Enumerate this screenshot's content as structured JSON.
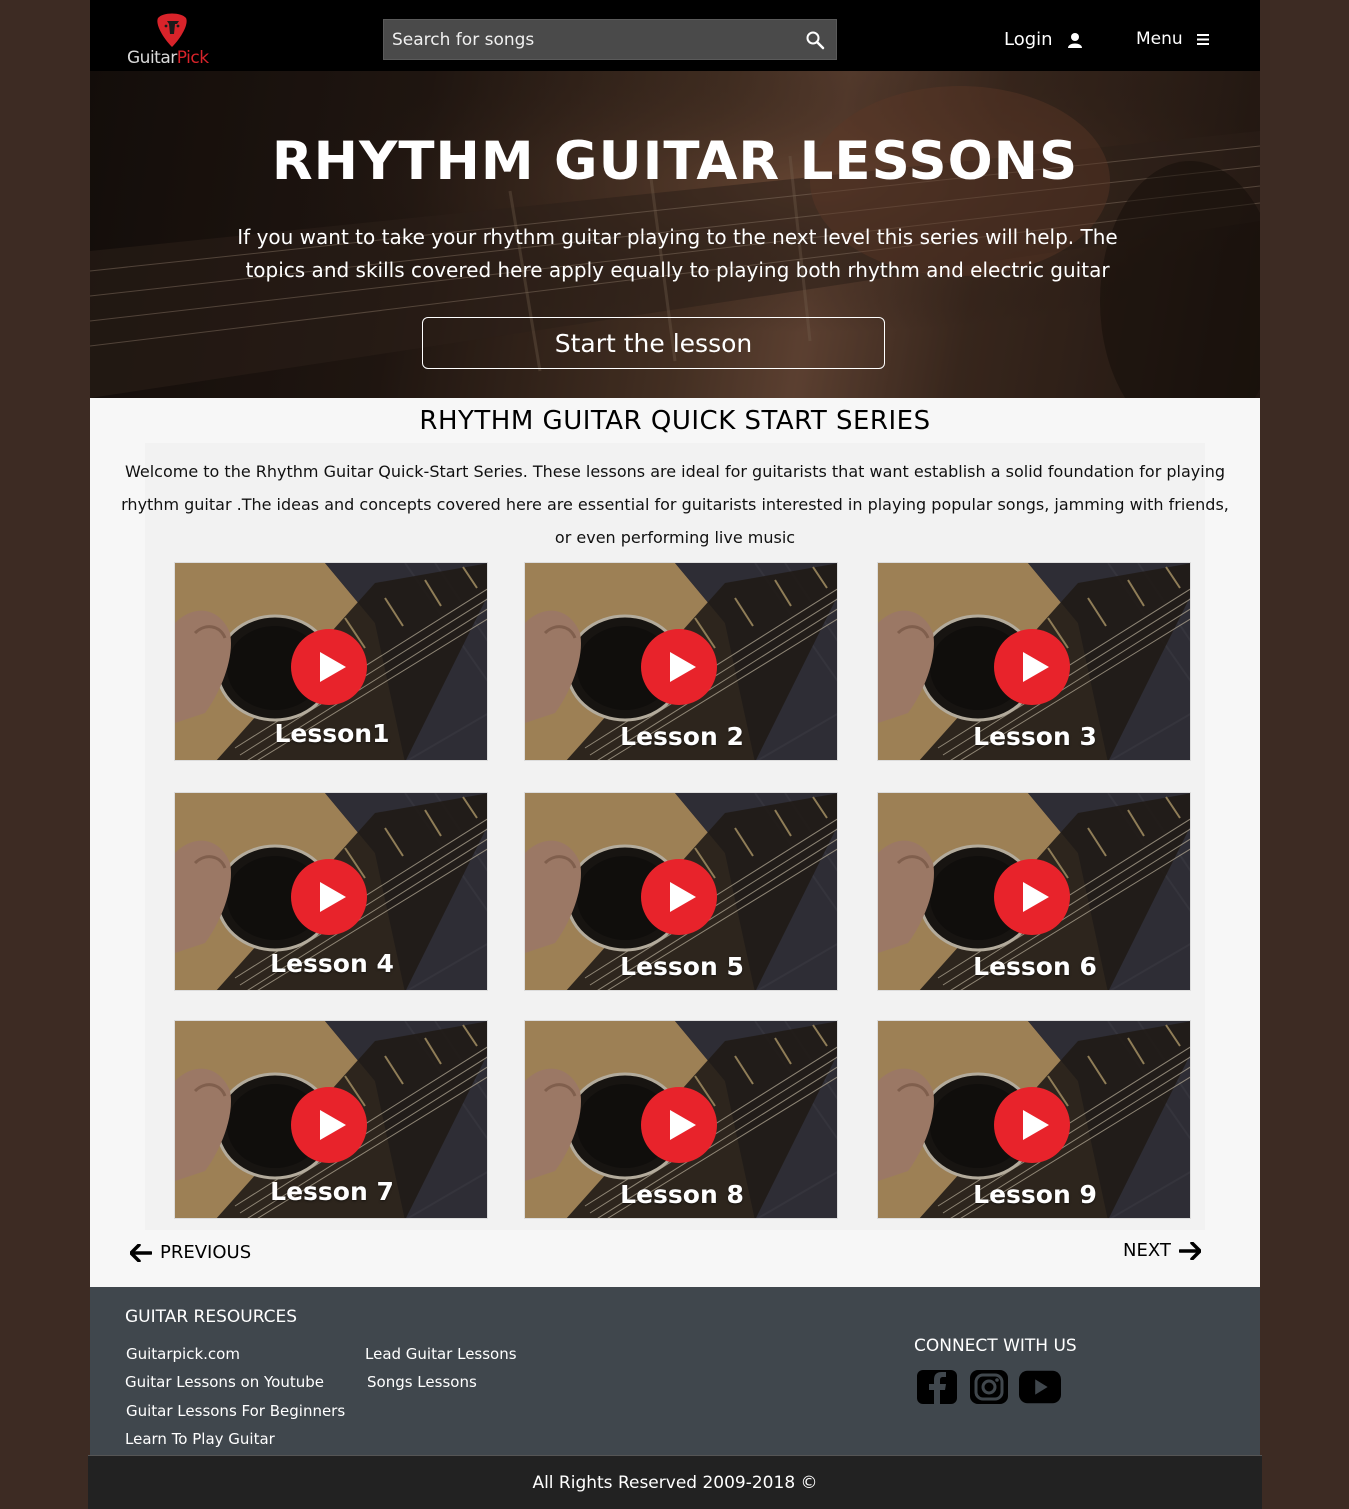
{
  "header": {
    "logo": {
      "word1": "Guitar",
      "word2": "Pick"
    },
    "search": {
      "placeholder": "Search for songs"
    },
    "login_label": "Login",
    "menu_label": "Menu"
  },
  "hero": {
    "title": "RHYTHM GUITAR LESSONS",
    "description": "If you want to take your rhythm guitar playing to the next level this series will help. The topics and skills covered here apply equally to playing both rhythm and electric guitar",
    "button_label": "Start the lesson"
  },
  "series": {
    "title": "RHYTHM GUITAR QUICK START SERIES",
    "intro": "Welcome to the Rhythm Guitar Quick-Start Series. These lessons are ideal for guitarists that want establish a solid foundation for playing rhythm guitar .The ideas and concepts covered here are essential for guitarists interested in playing popular songs, jamming with friends, or even performing live music",
    "lessons": [
      {
        "label": "Lesson1"
      },
      {
        "label": "Lesson 2"
      },
      {
        "label": "Lesson 3"
      },
      {
        "label": "Lesson 4"
      },
      {
        "label": "Lesson 5"
      },
      {
        "label": "Lesson 6"
      },
      {
        "label": "Lesson 7"
      },
      {
        "label": "Lesson 8"
      },
      {
        "label": "Lesson 9"
      }
    ]
  },
  "pagination": {
    "previous_label": "PREVIOUS",
    "next_label": "NEXT"
  },
  "footer": {
    "resources_heading": "GUITAR RESOURCES",
    "links_col1": [
      "Guitarpick.com",
      "Guitar Lessons on Youtube",
      "Guitar Lessons For Beginners",
      "Learn To Play Guitar"
    ],
    "links_col2": [
      "Lead Guitar Lessons",
      "Songs Lessons"
    ],
    "connect_heading": "CONNECT WITH US",
    "social_icons": [
      "facebook-icon",
      "instagram-icon",
      "youtube-icon"
    ],
    "copyright": "All Rights Reserved  2009-2018 ©"
  },
  "colors": {
    "brand_red": "#d8232a",
    "header_bg": "#000000",
    "footer_bg": "#40474d",
    "bottombar_bg": "#222222",
    "page_outer_bg": "#3d2b23"
  }
}
